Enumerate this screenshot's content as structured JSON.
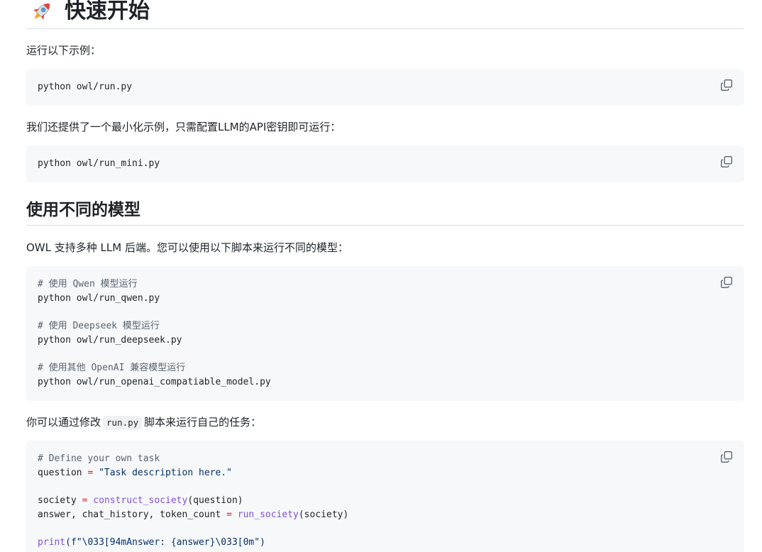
{
  "heading_main": "快速开始",
  "para_run_example": "运行以下示例：",
  "code_run": "python owl/run.py",
  "para_minimal": "我们还提供了一个最小化示例，只需配置LLM的API密钥即可运行：",
  "code_run_mini": "python owl/run_mini.py",
  "heading_models": "使用不同的模型",
  "para_backends": "OWL 支持多种 LLM 后端。您可以使用以下脚本来运行不同的模型：",
  "models_code": {
    "c1": "# 使用 Qwen 模型运行",
    "l1": "python owl/run_qwen.py",
    "c2": "# 使用 Deepseek 模型运行",
    "l2": "python owl/run_deepseek.py",
    "c3": "# 使用其他 OpenAI 兼容模型运行",
    "l3": "python owl/run_openai_compatiable_model.py"
  },
  "para_custom": {
    "before": "你可以通过修改",
    "code": "run.py",
    "after": "脚本来运行自己的任务："
  },
  "task_code": {
    "comment": "# Define your own task",
    "q_var": "question",
    "eq": "=",
    "q_val": "\"Task description here.\"",
    "s_var": "society",
    "s_fn": "construct_society",
    "s_args": "(question)",
    "a_vars": "answer, chat_history, token_count",
    "a_fn": "run_society",
    "a_args": "(society)",
    "p_fn": "print",
    "p_args": "(f\"\\033[94mAnswer: {answer}\\033[0m\")"
  }
}
